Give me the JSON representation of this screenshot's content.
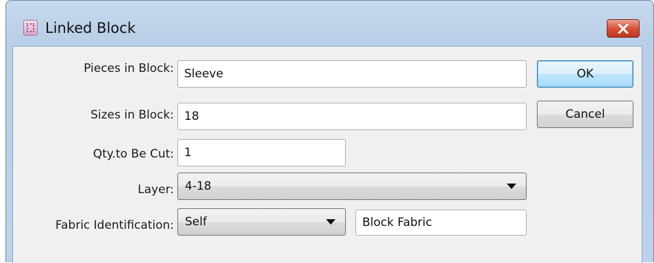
{
  "window": {
    "title": "Linked Block",
    "app_icon": "quilt-block-icon",
    "close_icon": "close-icon"
  },
  "form": {
    "pieces_label": "Pieces in Block:",
    "pieces_value": "Sleeve",
    "sizes_label": "Sizes in Block:",
    "sizes_value": "18",
    "qty_label": "Qty.to Be Cut:",
    "qty_value": "1",
    "layer_label": "Layer:",
    "layer_value": "4-18",
    "fabric_label": "Fabric Identification:",
    "fabric_value": "Self",
    "fabric_name_value": "Block Fabric"
  },
  "buttons": {
    "ok": "OK",
    "cancel": "Cancel"
  },
  "colors": {
    "frame": "#bdd2ea",
    "client": "#f0f0f0",
    "close_button": "#d44c33",
    "default_button": "#bee6fd"
  }
}
